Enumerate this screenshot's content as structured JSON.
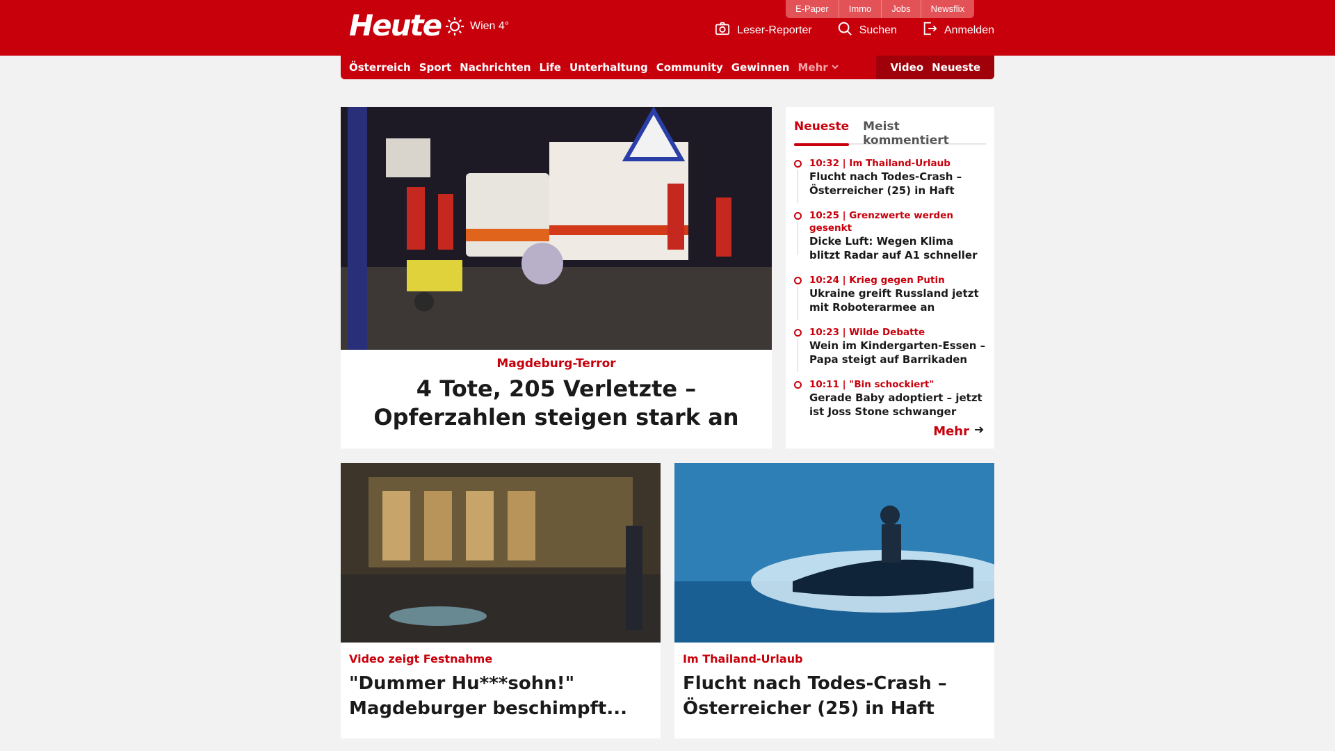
{
  "header": {
    "logo": "Heute",
    "weather": "Wien 4°",
    "util_nav": [
      "E-Paper",
      "Immo",
      "Jobs",
      "Newsflix"
    ],
    "actions": {
      "reporter": "Leser-Reporter",
      "search": "Suchen",
      "login": "Anmelden"
    },
    "brand_color": "#c8000c"
  },
  "nav": {
    "items": [
      "Österreich",
      "Sport",
      "Nachrichten",
      "Life",
      "Unterhaltung",
      "Community",
      "Gewinnen"
    ],
    "more": "Mehr",
    "right": [
      "Video",
      "Neueste"
    ]
  },
  "hero": {
    "kicker": "Magdeburg-Terror",
    "title": "4 Tote, 205 Verletzte – Opferzahlen steigen stark an"
  },
  "sidebar": {
    "tabs": [
      "Neueste",
      "Meist kommentiert"
    ],
    "items": [
      {
        "time": "10:32 | Im Thailand-Urlaub",
        "headline": "Flucht nach Todes-Crash – Österreicher (25) in Haft"
      },
      {
        "time": "10:25 | Grenzwerte werden gesenkt",
        "headline": "Dicke Luft: Wegen Klima blitzt Radar auf A1 schneller"
      },
      {
        "time": "10:24 | Krieg gegen Putin",
        "headline": "Ukraine greift Russland jetzt mit Roboterarmee an"
      },
      {
        "time": "10:23 | Wilde Debatte",
        "headline": "Wein im Kindergarten-Essen – Papa steigt auf Barrikaden"
      },
      {
        "time": "10:11 | \"Bin schockiert\"",
        "headline": "Gerade Baby adoptiert – jetzt ist Joss Stone schwanger"
      }
    ],
    "more": "Mehr"
  },
  "cards": [
    {
      "kicker": "Video zeigt Festnahme",
      "title": "\"Dummer Hu***sohn!\" Magdeburger beschimpft..."
    },
    {
      "kicker": "Im Thailand-Urlaub",
      "title": "Flucht nach Todes-Crash – Österreicher (25) in Haft"
    }
  ]
}
